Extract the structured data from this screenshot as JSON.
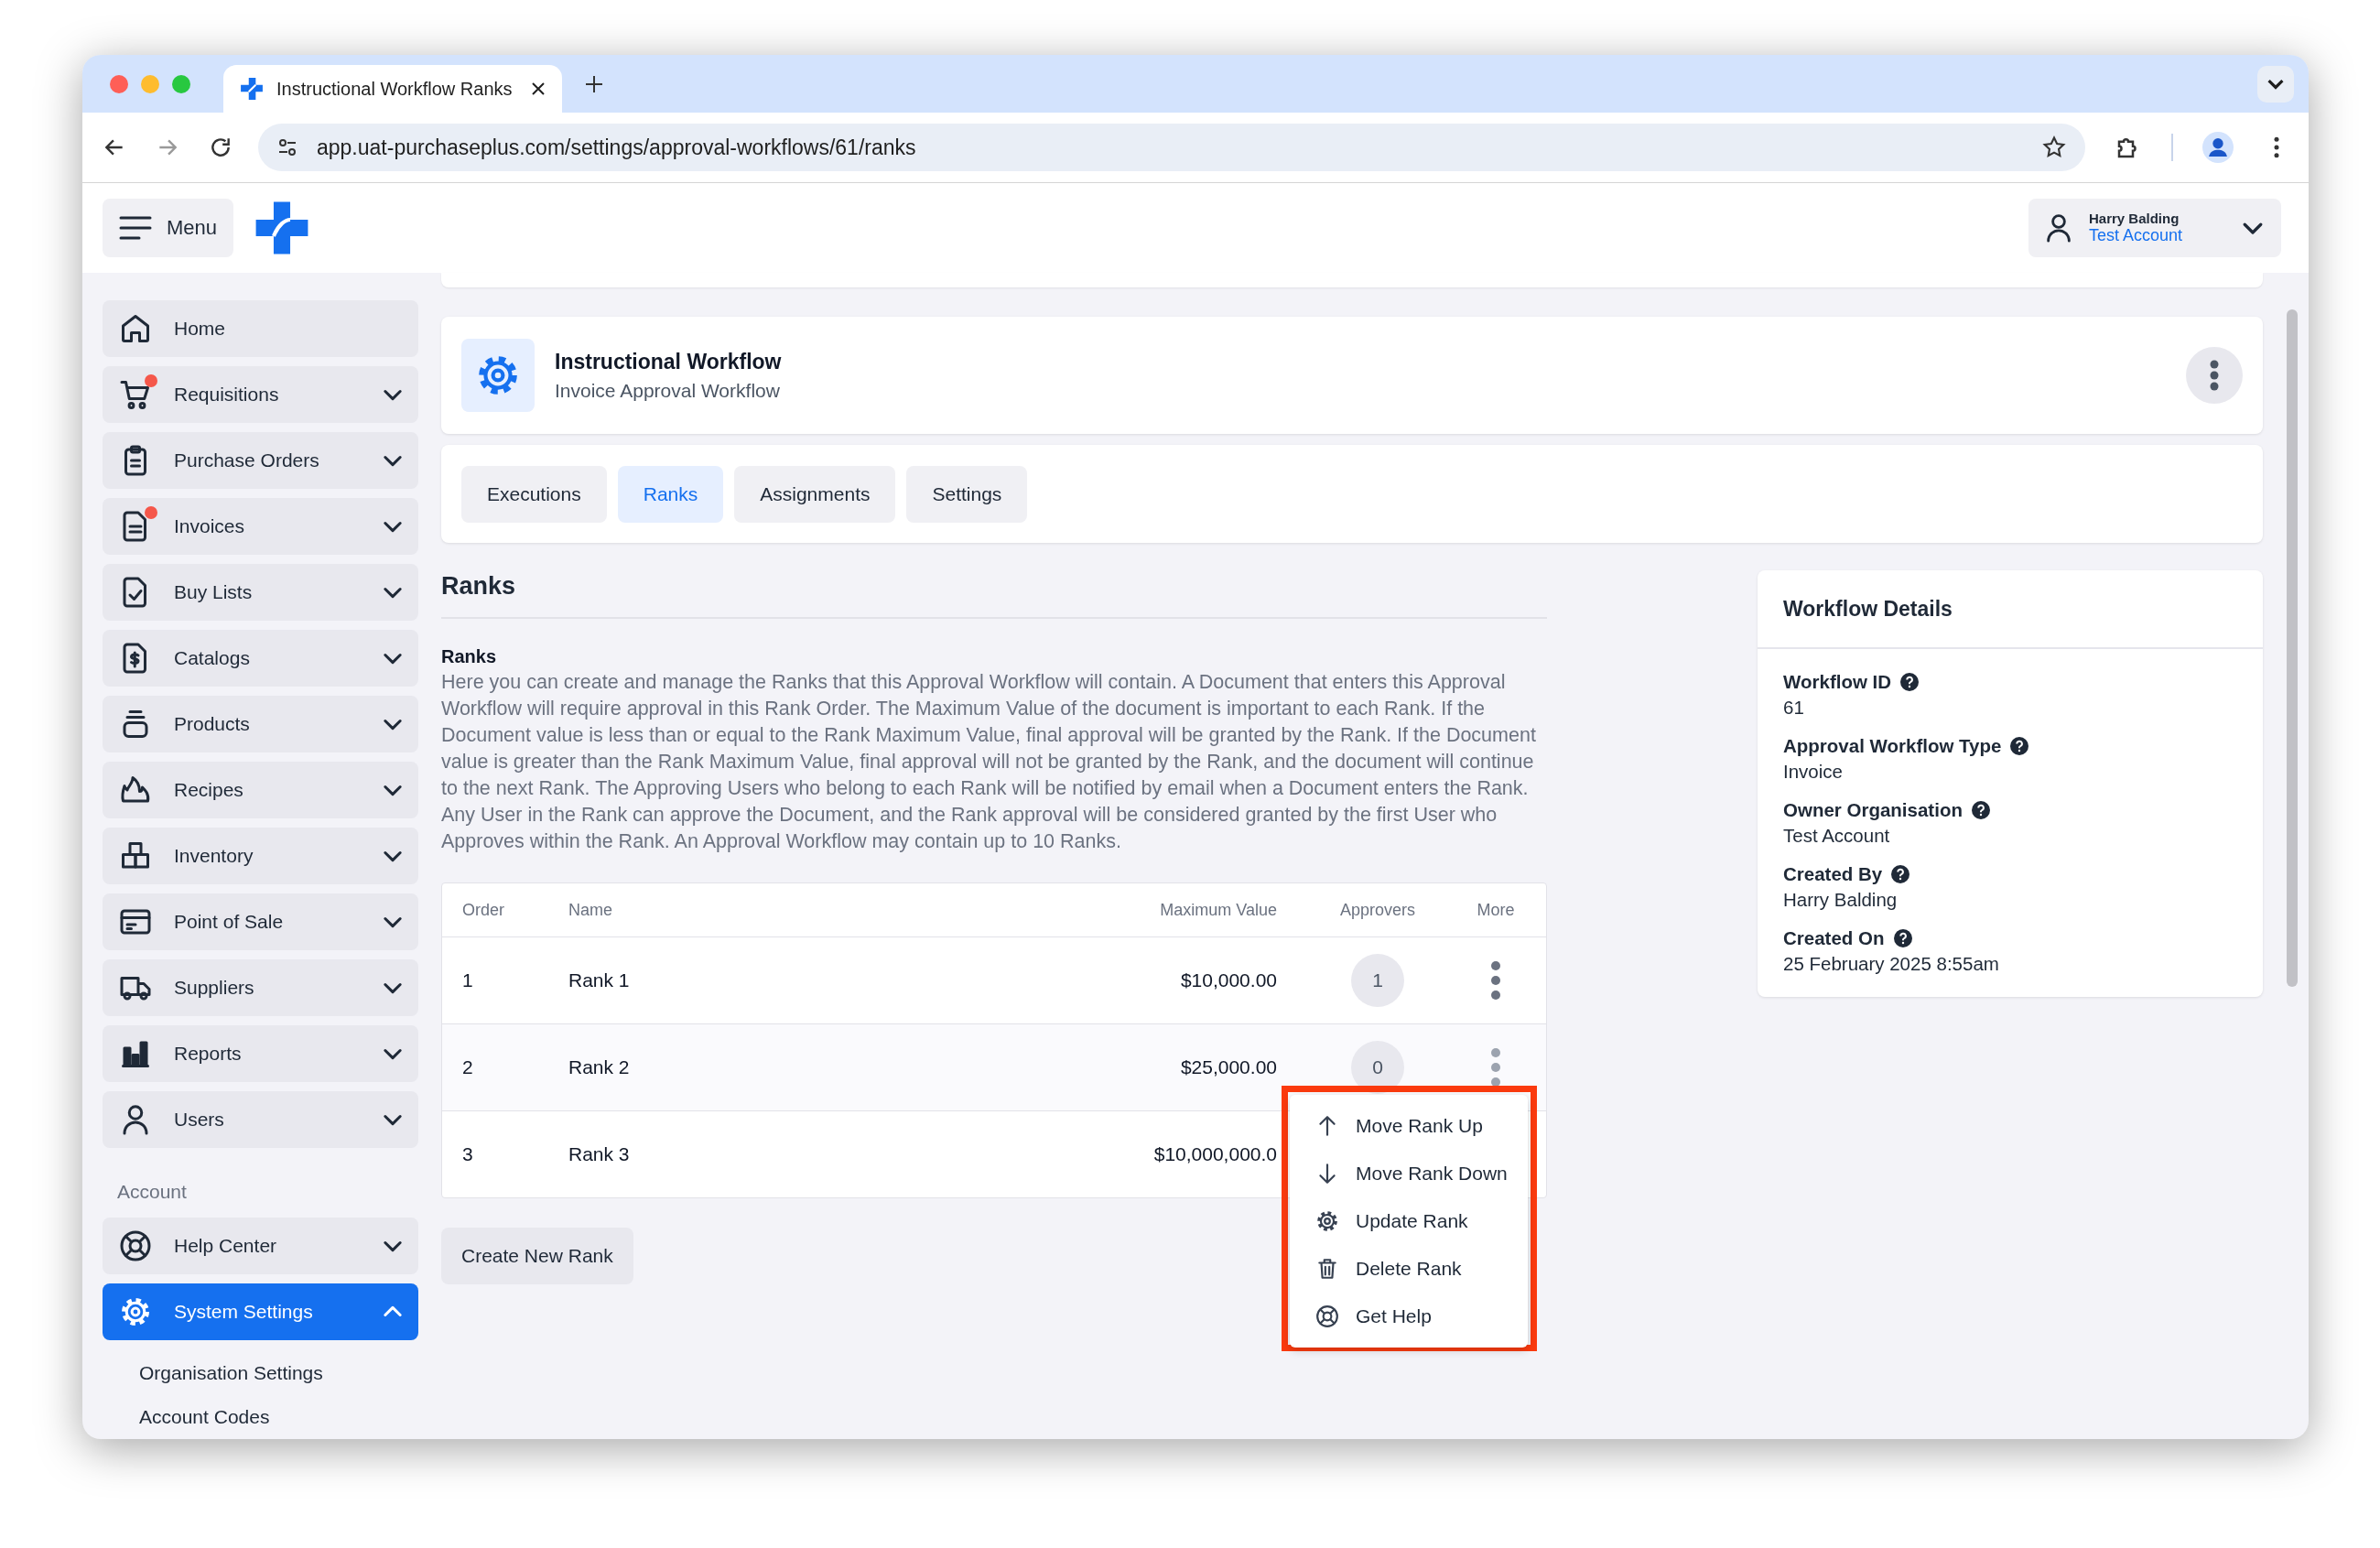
{
  "browser": {
    "tab_title": "Instructional Workflow Ranks",
    "url": "app.uat-purchaseplus.com/settings/approval-workflows/61/ranks"
  },
  "header": {
    "menu_label": "Menu",
    "user_name": "Harry Balding",
    "user_account": "Test Account"
  },
  "sidebar": {
    "items": [
      {
        "label": "Home",
        "kind": "link",
        "notification": false,
        "selected": false
      },
      {
        "label": "Requisitions",
        "kind": "group",
        "notification": true,
        "expanded": false,
        "selected": false
      },
      {
        "label": "Purchase Orders",
        "kind": "group",
        "notification": false,
        "expanded": false,
        "selected": false
      },
      {
        "label": "Invoices",
        "kind": "group",
        "notification": true,
        "expanded": false,
        "selected": false
      },
      {
        "label": "Buy Lists",
        "kind": "group",
        "notification": false,
        "expanded": false,
        "selected": false
      },
      {
        "label": "Catalogs",
        "kind": "group",
        "notification": false,
        "expanded": false,
        "selected": false
      },
      {
        "label": "Products",
        "kind": "group",
        "notification": false,
        "expanded": false,
        "selected": false
      },
      {
        "label": "Recipes",
        "kind": "group",
        "notification": false,
        "expanded": false,
        "selected": false
      },
      {
        "label": "Inventory",
        "kind": "group",
        "notification": false,
        "expanded": false,
        "selected": false
      },
      {
        "label": "Point of Sale",
        "kind": "group",
        "notification": false,
        "expanded": false,
        "selected": false
      },
      {
        "label": "Suppliers",
        "kind": "group",
        "notification": false,
        "expanded": false,
        "selected": false
      },
      {
        "label": "Reports",
        "kind": "group",
        "notification": false,
        "expanded": false,
        "selected": false
      },
      {
        "label": "Users",
        "kind": "group",
        "notification": false,
        "expanded": false,
        "selected": false
      }
    ],
    "section_label": "Account",
    "account_items": [
      {
        "label": "Help Center",
        "kind": "group",
        "notification": false,
        "expanded": false,
        "selected": false
      },
      {
        "label": "System Settings",
        "kind": "group",
        "notification": false,
        "expanded": true,
        "selected": true
      }
    ],
    "sub_items": [
      "Organisation Settings",
      "Account Codes"
    ]
  },
  "workflow": {
    "title": "Instructional Workflow",
    "subtitle": "Invoice Approval Workflow"
  },
  "tabs": [
    {
      "label": "Executions",
      "selected": false
    },
    {
      "label": "Ranks",
      "selected": true
    },
    {
      "label": "Assignments",
      "selected": false
    },
    {
      "label": "Settings",
      "selected": false
    }
  ],
  "ranks": {
    "heading": "Ranks",
    "subheading": "Ranks",
    "description": "Here you can create and manage the Ranks that this Approval Workflow will contain. A Document that enters this Approval Workflow will require approval in this Rank Order. The Maximum Value of the document is important to each Rank. If the Document value is less than or equal to the Rank Maximum Value, final approval will be granted by the Rank. If the Document value is greater than the Rank Maximum Value, final approval will not be granted by the Rank, and the document will continue to the next Rank. The Approving Users who belong to each Rank will be notified by email when a Document enters the Rank. Any User in the Rank can approve the Document, and the Rank approval will be considered granted by the first User who Approves within the Rank. An Approval Workflow may contain up to 10 Ranks.",
    "columns": [
      "Order",
      "Name",
      "Maximum Value",
      "Approvers",
      "More"
    ],
    "rows": [
      {
        "order": "1",
        "name": "Rank 1",
        "max_value": "$10,000.00",
        "approvers": "1",
        "more": true
      },
      {
        "order": "2",
        "name": "Rank 2",
        "max_value": "$25,000.00",
        "approvers": "0",
        "more": true
      },
      {
        "order": "3",
        "name": "Rank 3",
        "max_value": "$10,000,000.0"
      }
    ],
    "create_button": "Create New Rank"
  },
  "context_menu": {
    "highlighted": true,
    "items": [
      {
        "label": "Move Rank Up",
        "kind": "up"
      },
      {
        "label": "Move Rank Down",
        "kind": "down"
      },
      {
        "label": "Update Rank",
        "kind": "settings"
      },
      {
        "label": "Delete Rank",
        "kind": "delete"
      },
      {
        "label": "Get Help",
        "kind": "help"
      }
    ]
  },
  "details": {
    "title": "Workflow Details",
    "fields": [
      {
        "label": "Workflow ID",
        "value": "61"
      },
      {
        "label": "Approval Workflow Type",
        "value": "Invoice"
      },
      {
        "label": "Owner Organisation",
        "value": "Test Account"
      },
      {
        "label": "Created By",
        "value": "Harry Balding"
      },
      {
        "label": "Created On",
        "value": "25 February 2025 8:55am"
      }
    ]
  }
}
